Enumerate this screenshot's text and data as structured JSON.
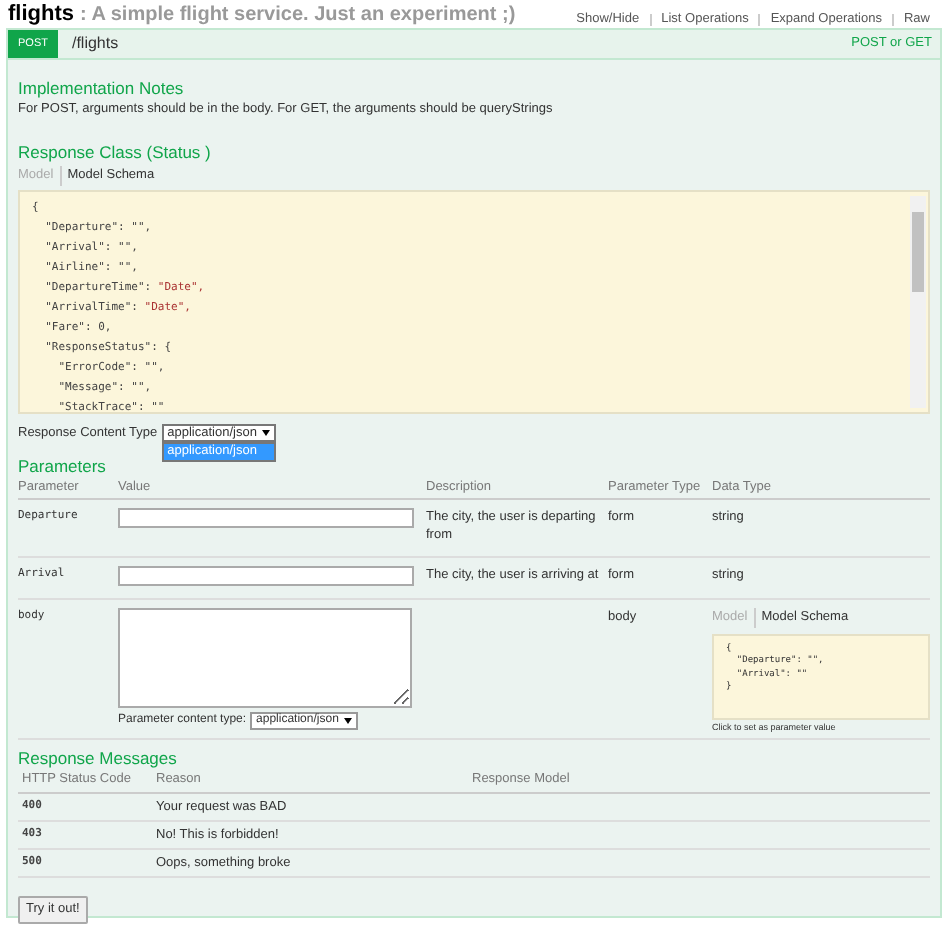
{
  "header": {
    "title": "flights",
    "subtitle": ": A simple flight service. Just an experiment ;)",
    "links": [
      "Show/Hide",
      "List Operations",
      "Expand Operations",
      "Raw"
    ]
  },
  "operation": {
    "method": "POST",
    "path": "/flights",
    "summary": "POST or GET"
  },
  "implementation_notes": {
    "heading": "Implementation Notes",
    "text": "For POST, arguments should be in the body. For GET, the arguments should be queryStrings"
  },
  "response_class": {
    "heading": "Response Class (Status )",
    "tabs": [
      {
        "label": "Model",
        "selected": false
      },
      {
        "label": "Model Schema",
        "selected": true
      }
    ],
    "schema_lines": [
      {
        "text": "{"
      },
      {
        "text": "  \"Departure\": \"\","
      },
      {
        "text": "  \"Arrival\": \"\","
      },
      {
        "text": "  \"Airline\": \"\","
      },
      {
        "text": "  \"DepartureTime\": ",
        "value": "\"Date\","
      },
      {
        "text": "  \"ArrivalTime\": ",
        "value": "\"Date\","
      },
      {
        "text": "  \"Fare\": 0,"
      },
      {
        "text": "  \"ResponseStatus\": {"
      },
      {
        "text": "    \"ErrorCode\": \"\","
      },
      {
        "text": "    \"Message\": \"\","
      },
      {
        "text": "    \"StackTrace\": \"\""
      }
    ]
  },
  "response_content_type": {
    "label": "Response Content Type",
    "value": "application/json",
    "expanded": true,
    "options": [
      {
        "label": "application/json",
        "selected": true
      }
    ]
  },
  "parameters": {
    "heading": "Parameters",
    "columns": [
      "Parameter",
      "Value",
      "Description",
      "Parameter Type",
      "Data Type"
    ],
    "rows": [
      {
        "kind": "input",
        "name": "Departure",
        "description": "The city, the user is departing from",
        "param_type": "form",
        "data_type": "string"
      },
      {
        "kind": "input",
        "name": "Arrival",
        "description": "The city, the user is arriving at",
        "param_type": "form",
        "data_type": "string"
      },
      {
        "kind": "body",
        "name": "body",
        "param_type": "body",
        "content_type_label": "Parameter content type:",
        "content_type": "application/json",
        "model_tabs": [
          {
            "label": "Model",
            "selected": false
          },
          {
            "label": "Model Schema",
            "selected": true
          }
        ],
        "schema_lines": [
          "{",
          "  \"Departure\": \"\",",
          "  \"Arrival\": \"\"",
          "}"
        ],
        "hint": "Click to set as parameter value"
      }
    ]
  },
  "response_messages": {
    "heading": "Response Messages",
    "columns": [
      "HTTP Status Code",
      "Reason",
      "Response Model"
    ],
    "rows": [
      {
        "code": "400",
        "reason": "Your request was BAD"
      },
      {
        "code": "403",
        "reason": "No! This is forbidden!"
      },
      {
        "code": "500",
        "reason": "Oops, something broke"
      }
    ]
  },
  "try_button": "Try it out!"
}
